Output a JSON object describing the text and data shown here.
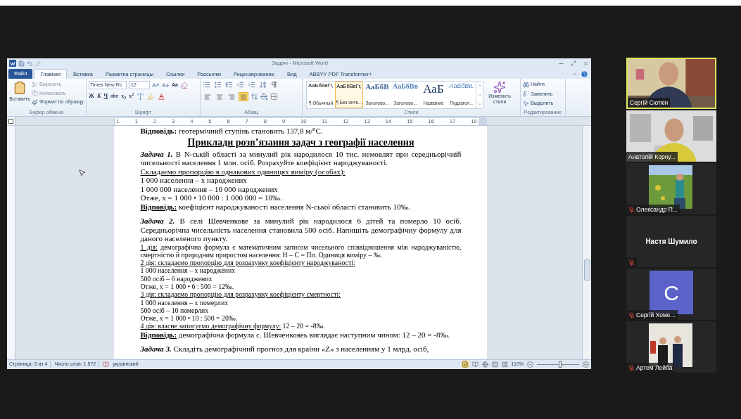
{
  "window": {
    "title": "Задачі - Microsoft Word"
  },
  "tabs": [
    {
      "label": "Файл",
      "kind": "file",
      "selected": false
    },
    {
      "label": "Главная",
      "kind": "tab",
      "selected": true
    },
    {
      "label": "Вставка",
      "kind": "tab",
      "selected": false
    },
    {
      "label": "Разметка страницы",
      "kind": "tab",
      "selected": false
    },
    {
      "label": "Ссылки",
      "kind": "tab",
      "selected": false
    },
    {
      "label": "Рассылки",
      "kind": "tab",
      "selected": false
    },
    {
      "label": "Рецензирование",
      "kind": "tab",
      "selected": false
    },
    {
      "label": "Вид",
      "kind": "tab",
      "selected": false
    },
    {
      "label": "ABBYY PDF Transformer+",
      "kind": "tab",
      "selected": false
    }
  ],
  "clipboard": {
    "paste": "Вставить",
    "items": [
      "Вырезать",
      "Копировать",
      "Формат по образцу"
    ],
    "label": "Буфер обмена"
  },
  "font": {
    "name": "Times New Rc",
    "size": "12",
    "case_button": "Aa",
    "buttons": [
      "Ж",
      "К",
      "Ч",
      "abc",
      "x$_{2}$",
      "x$^{2}$"
    ],
    "label": "Шрифт"
  },
  "paragraph": {
    "label": "Абзац",
    "alignments": [
      {
        "selected": false
      },
      {
        "selected": false
      },
      {
        "selected": false
      },
      {
        "selected": true
      }
    ]
  },
  "styles": {
    "label": "Стили",
    "items": [
      {
        "preview": "АаБбВвГг,",
        "name": "¶ Обычный",
        "kind": "normal",
        "selected": false
      },
      {
        "preview": "АаБбВвГг,",
        "name": "¶ Без инте...",
        "kind": "normal",
        "selected": true
      },
      {
        "preview": "АаБбВ",
        "name": "Заголово...",
        "kind": "heading1",
        "selected": false
      },
      {
        "preview": "АаБбВв",
        "name": "Заголово...",
        "kind": "heading2",
        "selected": false
      },
      {
        "preview": "АаБ",
        "name": "Название",
        "kind": "title",
        "selected": false
      },
      {
        "preview": "АаБбВв.",
        "name": "Подзагол...",
        "kind": "subtitle",
        "selected": false
      }
    ],
    "change": "Изменить стили"
  },
  "editing": {
    "label": "Редактирование",
    "items": [
      "Найти",
      "Заменить",
      "Выделить"
    ]
  },
  "ruler": [
    "1",
    "1",
    "2",
    "3",
    "4",
    "5",
    "6",
    "7",
    "8",
    "9",
    "10",
    "11",
    "12",
    "13",
    "14",
    "15",
    "16",
    "17",
    "19"
  ],
  "document": [
    {
      "kind": "body",
      "runs": [
        {
          "kind": "bold",
          "text": "Відповідь:"
        },
        {
          "kind": "plain",
          "text": " геотермічний ступінь становить 137,8 м/$^{о}$С."
        }
      ]
    },
    {
      "kind": "heading",
      "runs": [
        {
          "kind": "plain",
          "text": "Приклади розв’язання задач з географії населення"
        }
      ]
    },
    {
      "kind": "body",
      "runs": [
        {
          "kind": "bold-italic",
          "text": "Задача 1."
        },
        {
          "kind": "plain",
          "text": " В N-ській області за минулий рік народилося 10 тис. немовлят при середньорічній чисельності населення 1 млн. осіб. Розрахуйте коефіцієнт народжуваності."
        }
      ]
    },
    {
      "kind": "body",
      "runs": [
        {
          "kind": "underline",
          "text": "Складаємо пропорцію в однакових одиницях виміру (особах):"
        }
      ]
    },
    {
      "kind": "body",
      "runs": [
        {
          "kind": "plain",
          "text": "1 000 населення – х народжених"
        }
      ]
    },
    {
      "kind": "body",
      "runs": [
        {
          "kind": "plain",
          "text": "1 000 000 населення – 10 000 народжених"
        }
      ]
    },
    {
      "kind": "body",
      "runs": [
        {
          "kind": "plain",
          "text": "Отже, х = 1 000 • 10 000 : 1 000 000 = 10‰."
        }
      ]
    },
    {
      "kind": "body",
      "runs": [
        {
          "kind": "bold-underline",
          "text": "Відповідь:"
        },
        {
          "kind": "plain",
          "text": " коефіцієнт народжуваності населення N-ської області становить 10‰."
        }
      ]
    },
    {
      "kind": "spaced",
      "runs": [
        {
          "kind": "bold-italic",
          "text": "Задача 2."
        },
        {
          "kind": "plain",
          "text": " В селі Шевченкове за минулий рік народилося 6 дітей та померло 10 осіб. Середньорічна чисельність населення становила 500 осіб. Напишіть демографічну формулу для даного населеного пункту."
        }
      ]
    },
    {
      "kind": "small",
      "runs": [
        {
          "kind": "underline",
          "text": "1 дія:"
        },
        {
          "kind": "plain",
          "text": " демографічна формула є математичним записом чисельного співвідношення між народжуваністю, смертністю й природним приростом населення: Н – С = Пп. Одиниця виміру – ‰."
        }
      ]
    },
    {
      "kind": "small",
      "runs": [
        {
          "kind": "underline",
          "text": "2 дія: складаємо пропорцію для розрахунку коефіцієнту народжуваності:"
        }
      ]
    },
    {
      "kind": "small",
      "runs": [
        {
          "kind": "plain",
          "text": "1 000 населення – х народжених"
        }
      ]
    },
    {
      "kind": "small",
      "runs": [
        {
          "kind": "plain",
          "text": "500 осіб – 6 народжених"
        }
      ]
    },
    {
      "kind": "small",
      "runs": [
        {
          "kind": "plain",
          "text": "Отже, х = 1 000 • 6 : 500 = 12‰."
        }
      ]
    },
    {
      "kind": "small",
      "runs": [
        {
          "kind": "underline",
          "text": "3 дія: складаємо пропорцію для розрахунку коефіцієнту смертності:"
        }
      ]
    },
    {
      "kind": "small",
      "runs": [
        {
          "kind": "plain",
          "text": "1 000 населення – х померлих"
        }
      ]
    },
    {
      "kind": "small",
      "runs": [
        {
          "kind": "plain",
          "text": "500 осіб – 10 померлих"
        }
      ]
    },
    {
      "kind": "small",
      "runs": [
        {
          "kind": "plain",
          "text": "Отже, х = 1 000 • 10 : 500 = 20‰."
        }
      ]
    },
    {
      "kind": "small",
      "runs": [
        {
          "kind": "underline",
          "text": "4 дія: власне записуємо демографічну формулу:"
        },
        {
          "kind": "plain",
          "text": " 12 – 20 = -8‰."
        }
      ]
    },
    {
      "kind": "body",
      "runs": [
        {
          "kind": "bold-underline",
          "text": "Відповідь:"
        },
        {
          "kind": "plain",
          "text": " демографічна формула с. Шевченковеь виглядає наступним чином: 12 – 20 = -8‰."
        }
      ]
    },
    {
      "kind": "spaced",
      "runs": [
        {
          "kind": "bold-italic",
          "text": "Задача 3."
        },
        {
          "kind": "plain",
          "text": " Складіть демографічний прогноз для країни «Z» з населенням у 1 млрд. осіб,"
        }
      ]
    }
  ],
  "status_bar": {
    "page": "Страница: 3 из 4",
    "words": "Число слов: 1 572",
    "language": "украинский",
    "zoom": "110%",
    "level": 0.55
  },
  "participants": [
    {
      "name": "Сергій Сюткін",
      "kind": "video",
      "active": true,
      "muted": false
    },
    {
      "name": "Анатолій Корну...",
      "kind": "video2",
      "active": false,
      "muted": false
    },
    {
      "name": "Олександр П...",
      "active": false,
      "muted": true
    },
    {
      "name": "Настя Шумило",
      "kind": "name",
      "active": false,
      "muted": true
    },
    {
      "name": "Сергій Хоме...",
      "kind": "avatar",
      "letter": "С",
      "color": "#5b63c9",
      "active": false,
      "muted": true
    },
    {
      "name": "Артем Лейба",
      "kind": "photo2",
      "active": false,
      "muted": true
    }
  ]
}
